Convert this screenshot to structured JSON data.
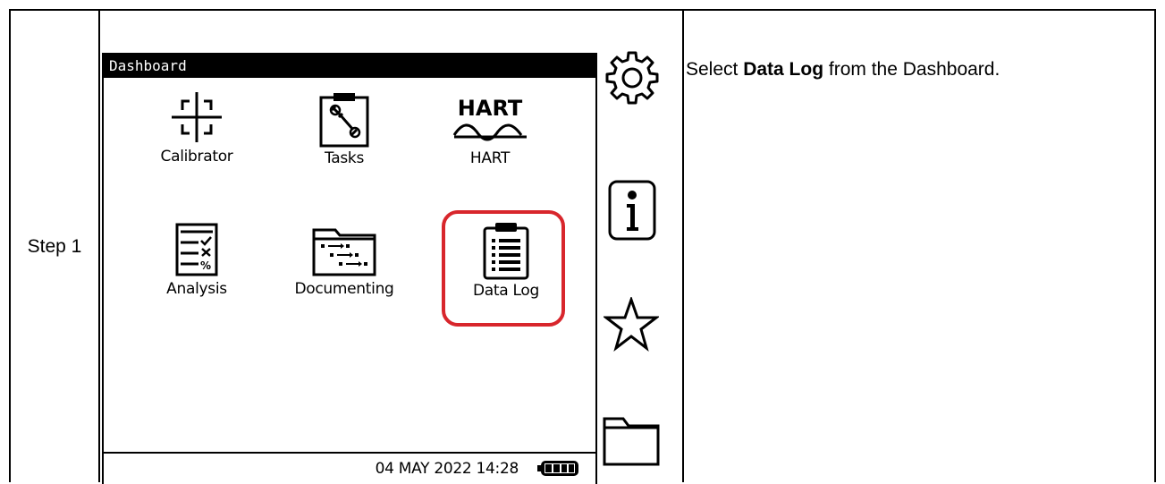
{
  "step": {
    "label": "Step 1"
  },
  "instruction": {
    "prefix": "Select ",
    "bold": "Data Log",
    "suffix": " from the Dashboard."
  },
  "device": {
    "title": "Dashboard",
    "apps": [
      {
        "label": "Calibrator",
        "icon": "crosshair-icon"
      },
      {
        "label": "Tasks",
        "icon": "clipboard-wrench-icon"
      },
      {
        "label": "HART",
        "icon": "hart-wave-icon",
        "logo_text": "HART"
      },
      {
        "label": "Analysis",
        "icon": "analysis-checklist-icon"
      },
      {
        "label": "Documenting",
        "icon": "documenting-folder-icon"
      },
      {
        "label": "Data Log",
        "icon": "data-log-clipboard-icon"
      }
    ],
    "status": {
      "datetime": "04 MAY 2022 14:28",
      "battery": "battery-full-icon"
    },
    "side_buttons": [
      "settings-gear-icon",
      "info-icon",
      "favorites-star-icon",
      "folder-icon"
    ],
    "highlight_color": "#d8262c"
  }
}
